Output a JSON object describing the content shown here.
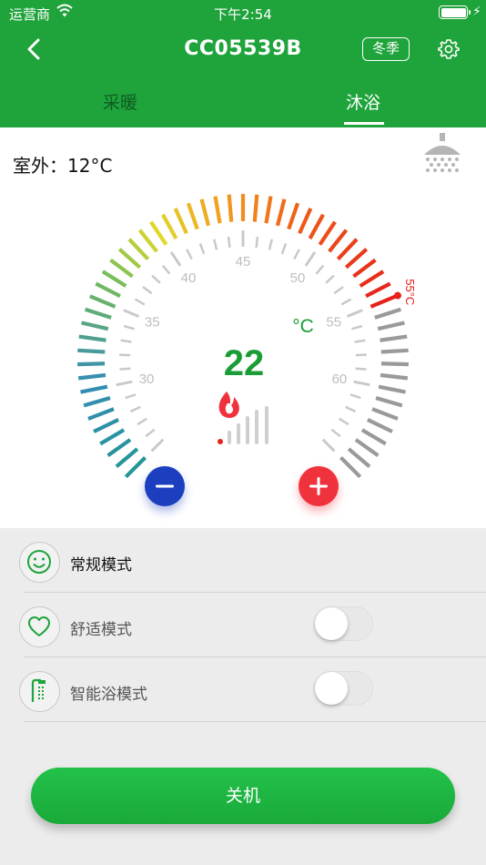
{
  "status_bar": {
    "carrier": "运营商",
    "time": "下午2:54"
  },
  "nav": {
    "title": "CC05539B",
    "season": "冬季"
  },
  "tabs": [
    {
      "label": "采暖",
      "active": false
    },
    {
      "label": "沐浴",
      "active": true
    }
  ],
  "panel": {
    "outdoor": "室外：12°C",
    "current_temp": "22",
    "unit": "°C",
    "setpoint_label": "55°C",
    "setpoint_value": 55,
    "scale_min": 25,
    "scale_max": 65,
    "scale_labels": [
      "30",
      "35",
      "40",
      "45",
      "50",
      "55",
      "60"
    ],
    "flame_level": 0.2
  },
  "modes": [
    {
      "label": "常规模式",
      "icon": "smiley-icon",
      "has_toggle": false
    },
    {
      "label": "舒适模式",
      "icon": "heart-icon",
      "has_toggle": true,
      "on": false
    },
    {
      "label": "智能浴模式",
      "icon": "smart-shower-icon",
      "has_toggle": true,
      "on": false
    }
  ],
  "power_button": "关机",
  "colors": {
    "brand": "#1fa33b",
    "minus": "#1c3fbf",
    "plus": "#f0323d",
    "temp_text": "#1a9c36",
    "setpoint": "#e8221b"
  }
}
